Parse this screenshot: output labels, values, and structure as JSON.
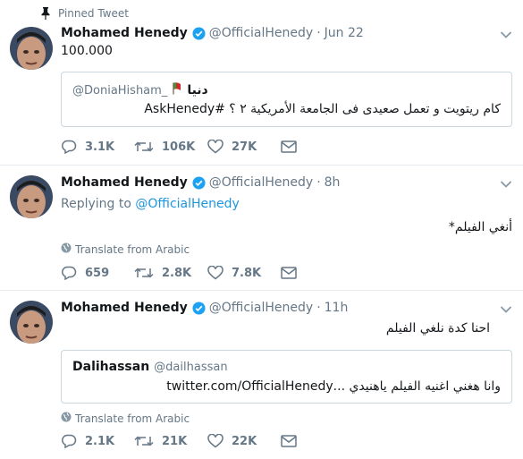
{
  "tweets": [
    {
      "pinned_label": "Pinned Tweet",
      "name": "Mohamed Henedy",
      "handle": "@OfficialHenedy",
      "time": "Jun 22",
      "text": "100.000",
      "quote": {
        "author_name": "دنيا",
        "author_handle": "@DoniaHisham_",
        "text": "كام ريتويت و تعمل صعيدى فى الجامعة الأمريكية ٢ ؟ #AskHenedy"
      },
      "actions": {
        "reply": "3.1K",
        "retweet": "106K",
        "like": "27K"
      }
    },
    {
      "name": "Mohamed Henedy",
      "handle": "@OfficialHenedy",
      "time": "8h",
      "replying_prefix": "Replying to",
      "replying_to": "@OfficialHenedy",
      "text": "أنغي الفيلم*",
      "translate": "Translate from Arabic",
      "actions": {
        "reply": "659",
        "retweet": "2.8K",
        "like": "7.8K"
      }
    },
    {
      "name": "Mohamed Henedy",
      "handle": "@OfficialHenedy",
      "time": "11h",
      "text": "احنا كدة نلغي الفيلم",
      "quote": {
        "author_name": "Dalihassan",
        "author_handle": "@dailhassan",
        "text": "وانا هغني اغنيه الفيلم ياهنيدي ...twitter.com/OfficialHenedy"
      },
      "translate": "Translate from Arabic",
      "actions": {
        "reply": "2.1K",
        "retweet": "21K",
        "like": "22K"
      }
    }
  ],
  "colors": {
    "accent": "#1da1f2",
    "muted": "#657786",
    "border": "#e6ecf0",
    "text": "#14171a"
  }
}
